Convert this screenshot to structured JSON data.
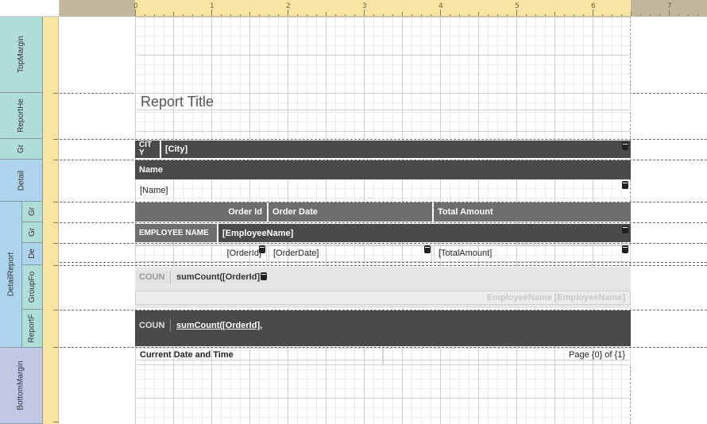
{
  "ruler": {
    "marks": [
      "0",
      "1",
      "2",
      "3",
      "4",
      "5",
      "6",
      "7"
    ]
  },
  "bands": {
    "top_margin": "TopMargin",
    "report_header": "ReportHe",
    "group_header_city": "Gr",
    "detail": "Detail",
    "detail_report": "DetailReport",
    "group_header_1": "Gr",
    "group_header_2": "Gr",
    "detail_sub": "De",
    "group_footer": "GroupFo",
    "report_footer": "ReportF",
    "bottom_margin": "BottomMargin"
  },
  "report": {
    "title": "Report Title",
    "city_caption": "CIT\nY",
    "city_field": "[City]",
    "name_caption": "Name",
    "name_field": "[Name]",
    "col_order_id": "Order Id",
    "col_order_date": "Order Date",
    "col_total_amount": "Total Amount",
    "employee_caption": "EMPLOYEE NAME",
    "employee_field": "[EmployeeName]",
    "order_id_field": "[OrderId]",
    "order_date_field": "[OrderDate]",
    "total_amount_field": "[TotalAmount]",
    "group_count_caption": "COUN",
    "group_count_expr": "sumCount([OrderId]",
    "group_footer_text": "EmployeeName [EmployeeName]",
    "report_count_caption": "COUN",
    "report_count_expr": "sumCount([OrderId],",
    "footer_date": "Current Date and Time",
    "footer_page": "Page {0} of {1}"
  }
}
